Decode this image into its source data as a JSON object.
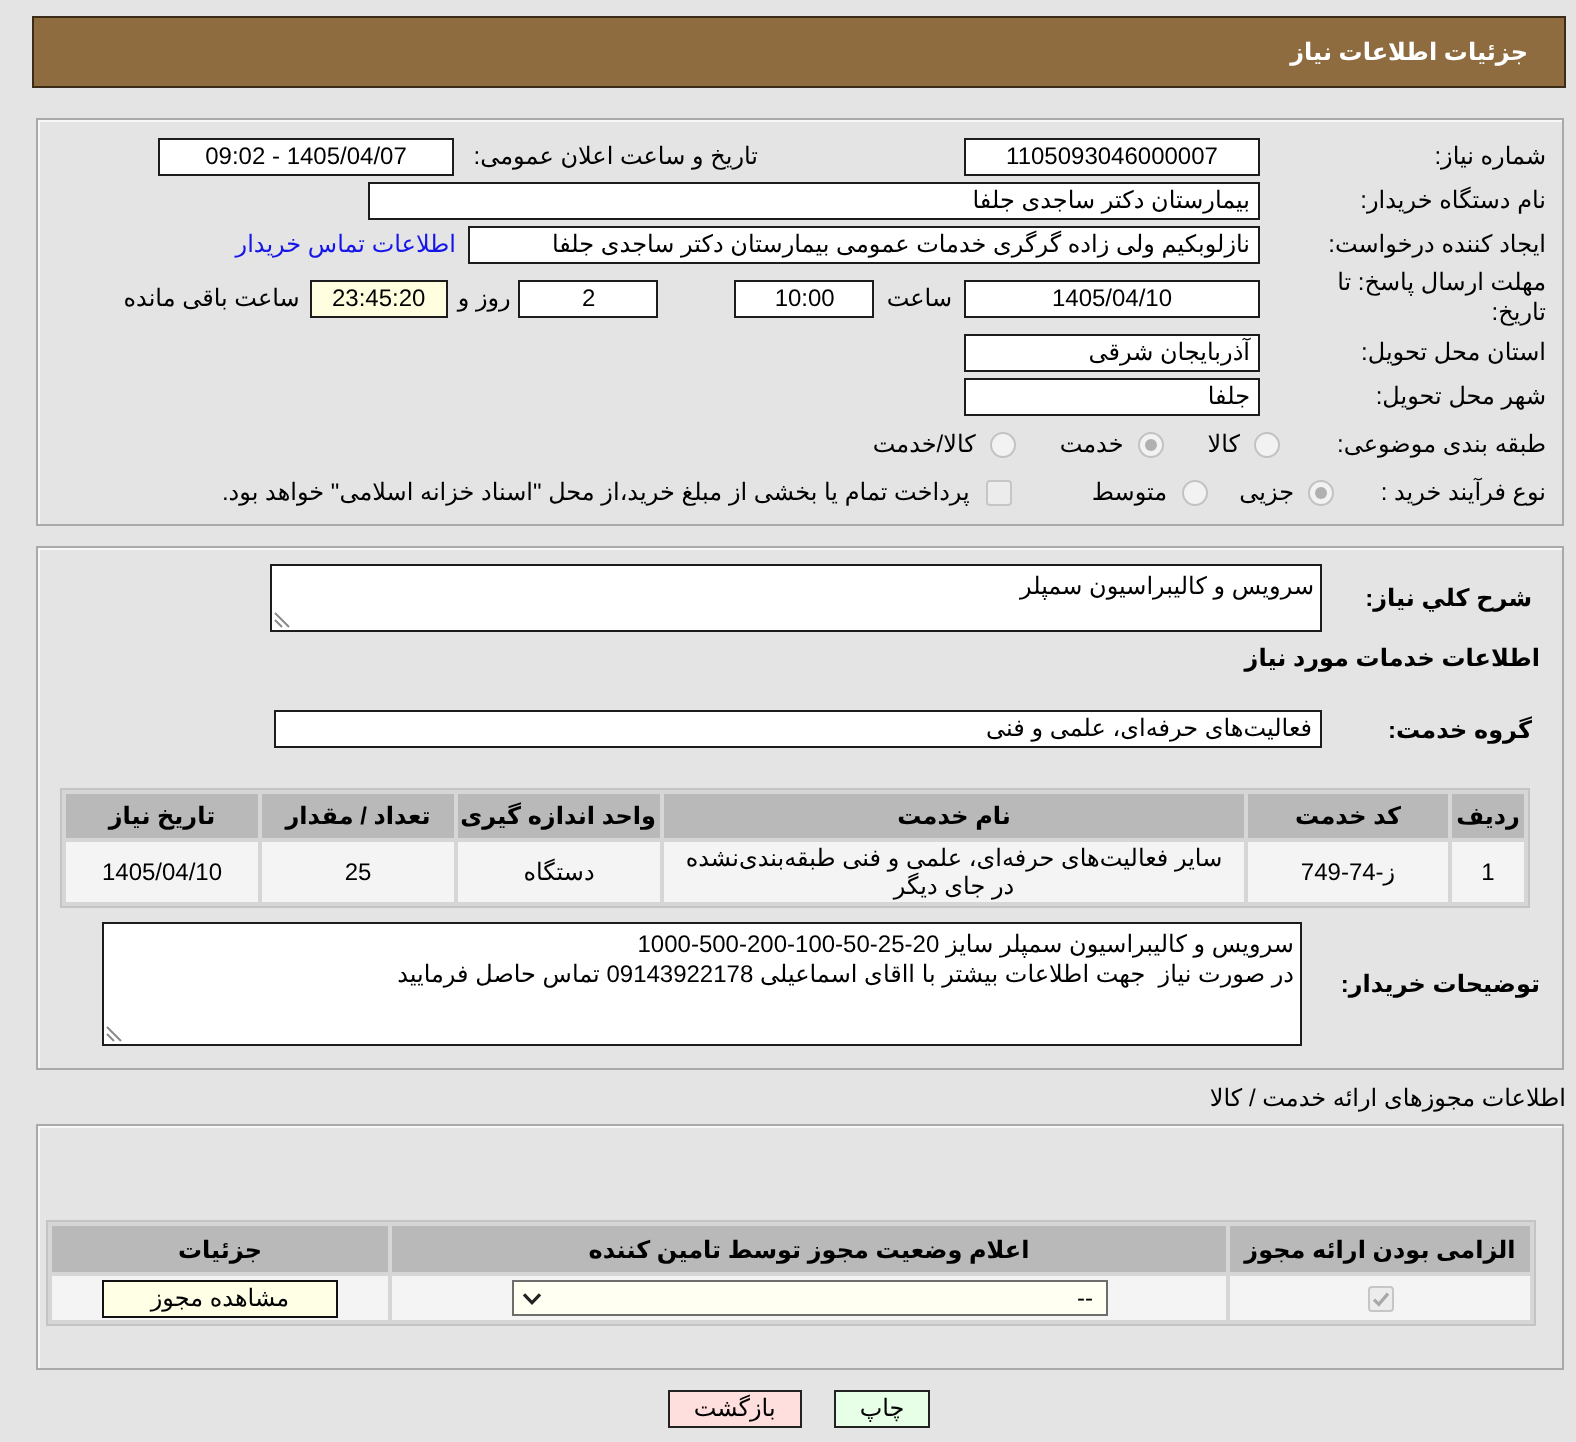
{
  "header": {
    "title": "جزئیات اطلاعات نیاز"
  },
  "details": {
    "need_number": {
      "label": "شماره نیاز:",
      "value": "1105093046000007"
    },
    "announce_date": {
      "label": "تاریخ و ساعت اعلان عمومی:",
      "value": "1405/04/07 - 09:02"
    },
    "buyer_org": {
      "label": "نام دستگاه خریدار:",
      "value": "بیمارستان دکتر ساجدی جلفا"
    },
    "requester": {
      "label": "ایجاد کننده درخواست:",
      "value": "نازلوبکیم ولی زاده گرگری خدمات عمومی بیمارستان دکتر ساجدی جلفا",
      "link": "اطلاعات تماس خریدار"
    },
    "deadline": {
      "label": "مهلت ارسال پاسخ: تا تاریخ:",
      "date": "1405/04/10",
      "time_label": "ساعت",
      "time": "10:00",
      "days": "2",
      "days_label": "روز و",
      "remaining": "23:45:20",
      "remaining_label": "ساعت باقی مانده"
    },
    "province": {
      "label": "استان محل تحویل:",
      "value": "آذربایجان شرقی"
    },
    "city": {
      "label": "شهر محل تحویل:",
      "value": "جلفا"
    },
    "category": {
      "label": "طبقه بندی موضوعی:",
      "options": [
        {
          "label": "کالا",
          "selected": false
        },
        {
          "label": "خدمت",
          "selected": true
        },
        {
          "label": "کالا/خدمت",
          "selected": false
        }
      ]
    },
    "process": {
      "label": "نوع فرآیند خرید :",
      "options": [
        {
          "label": "جزیی",
          "selected": true
        },
        {
          "label": "متوسط",
          "selected": false
        }
      ],
      "treasury": {
        "label": "پرداخت تمام یا بخشی از مبلغ خرید،از محل \"اسناد خزانه اسلامی\" خواهد بود.",
        "checked": false
      }
    }
  },
  "services": {
    "summary": {
      "label": "شرح کلي نیاز:",
      "value": "سرویس و کالیبراسیون سمپلر"
    },
    "section_title": "اطلاعات خدمات مورد نیاز",
    "service_group": {
      "label": "گروه خدمت:",
      "value": "فعالیت‌های حرفه‌ای، علمی و فنی"
    },
    "table": {
      "columns": [
        "ردیف",
        "کد خدمت",
        "نام خدمت",
        "واحد اندازه گیری",
        "تعداد / مقدار",
        "تاریخ نیاز"
      ],
      "rows": [
        [
          "1",
          "ز-74-749",
          "سایر فعالیت‌های حرفه‌ای، علمی و فنی طبقه‌بندی‌نشده در جای دیگر",
          "دستگاه",
          "25",
          "1405/04/10"
        ]
      ]
    },
    "buyer_notes": {
      "label": "توضیحات خریدار:",
      "lines": [
        "سرویس و کالیبراسیون سمپلر سایز 20-25-50-100-200-500-1000",
        "در صورت نیاز  جهت اطلاعات بیشتر با ااقای اسماعیلی 09143922178 تماس حاصل فرمایید"
      ]
    }
  },
  "permits": {
    "title": "اطلاعات مجوزهای ارائه خدمت / کالا",
    "table": {
      "columns": [
        "الزامی بودن ارائه مجوز",
        "اعلام وضعیت مجوز توسط تامین کننده",
        "جزئیات"
      ],
      "rows": [
        {
          "required": true,
          "status": "--",
          "details_button": "مشاهده مجوز"
        }
      ]
    }
  },
  "buttons": [
    {
      "label": "چاپ",
      "kind": "print"
    },
    {
      "label": "بازگشت",
      "kind": "back"
    }
  ]
}
